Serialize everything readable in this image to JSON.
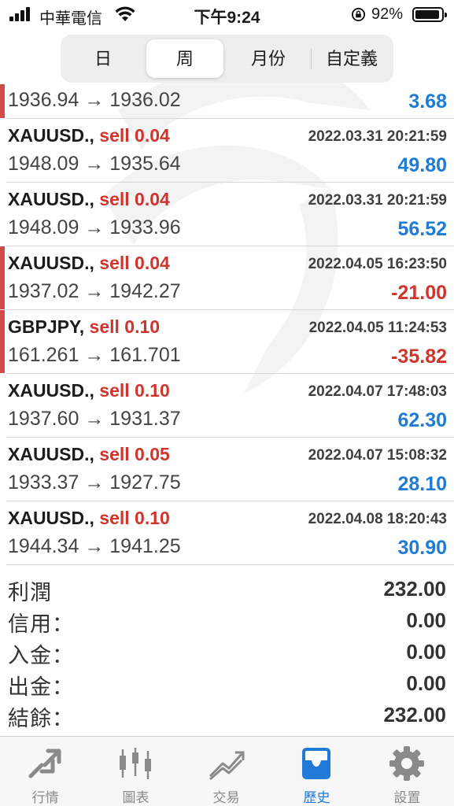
{
  "status_bar": {
    "carrier": "中華電信",
    "time": "下午9:24",
    "battery": "92%"
  },
  "period_tabs": [
    {
      "label": "日",
      "active": false
    },
    {
      "label": "周",
      "active": true
    },
    {
      "label": "月份",
      "active": false
    },
    {
      "label": "自定義",
      "active": false
    }
  ],
  "trades": [
    {
      "symbol": "",
      "side": "",
      "time": "",
      "prices": "1936.94 → 1936.02",
      "profit": "3.68",
      "profit_sign": "pos",
      "flagged": true,
      "partial": true
    },
    {
      "symbol": "XAUUSD.,",
      "side": "sell 0.04",
      "time": "2022.03.31 20:21:59",
      "prices": "1948.09 → 1935.64",
      "profit": "49.80",
      "profit_sign": "pos",
      "flagged": false
    },
    {
      "symbol": "XAUUSD.,",
      "side": "sell 0.04",
      "time": "2022.03.31 20:21:59",
      "prices": "1948.09 → 1933.96",
      "profit": "56.52",
      "profit_sign": "pos",
      "flagged": false
    },
    {
      "symbol": "XAUUSD.,",
      "side": "sell 0.04",
      "time": "2022.04.05 16:23:50",
      "prices": "1937.02 → 1942.27",
      "profit": "-21.00",
      "profit_sign": "neg",
      "flagged": true
    },
    {
      "symbol": "GBPJPY,",
      "side": "sell 0.10",
      "time": "2022.04.05 11:24:53",
      "prices": "161.261 → 161.701",
      "profit": "-35.82",
      "profit_sign": "neg",
      "flagged": true
    },
    {
      "symbol": "XAUUSD.,",
      "side": "sell 0.10",
      "time": "2022.04.07 17:48:03",
      "prices": "1937.60 → 1931.37",
      "profit": "62.30",
      "profit_sign": "pos",
      "flagged": false
    },
    {
      "symbol": "XAUUSD.,",
      "side": "sell 0.05",
      "time": "2022.04.07 15:08:32",
      "prices": "1933.37 → 1927.75",
      "profit": "28.10",
      "profit_sign": "pos",
      "flagged": false
    },
    {
      "symbol": "XAUUSD.,",
      "side": "sell 0.10",
      "time": "2022.04.08 18:20:43",
      "prices": "1944.34 → 1941.25",
      "profit": "30.90",
      "profit_sign": "pos",
      "flagged": false
    }
  ],
  "summary": [
    {
      "label": "利潤",
      "value": "232.00"
    },
    {
      "label": "信用：",
      "value": "0.00"
    },
    {
      "label": "入金：",
      "value": "0.00"
    },
    {
      "label": "出金：",
      "value": "0.00"
    },
    {
      "label": "結餘：",
      "value": "232.00"
    }
  ],
  "tab_bar": [
    {
      "label": "行情",
      "icon": "quotes-icon",
      "active": false
    },
    {
      "label": "圖表",
      "icon": "chart-icon",
      "active": false
    },
    {
      "label": "交易",
      "icon": "trade-icon",
      "active": false
    },
    {
      "label": "歷史",
      "icon": "history-icon",
      "active": true
    },
    {
      "label": "設置",
      "icon": "settings-icon",
      "active": false
    }
  ],
  "colors": {
    "accent": "#1f7bd6",
    "loss": "#d0342c",
    "flag": "#d24a4a"
  }
}
